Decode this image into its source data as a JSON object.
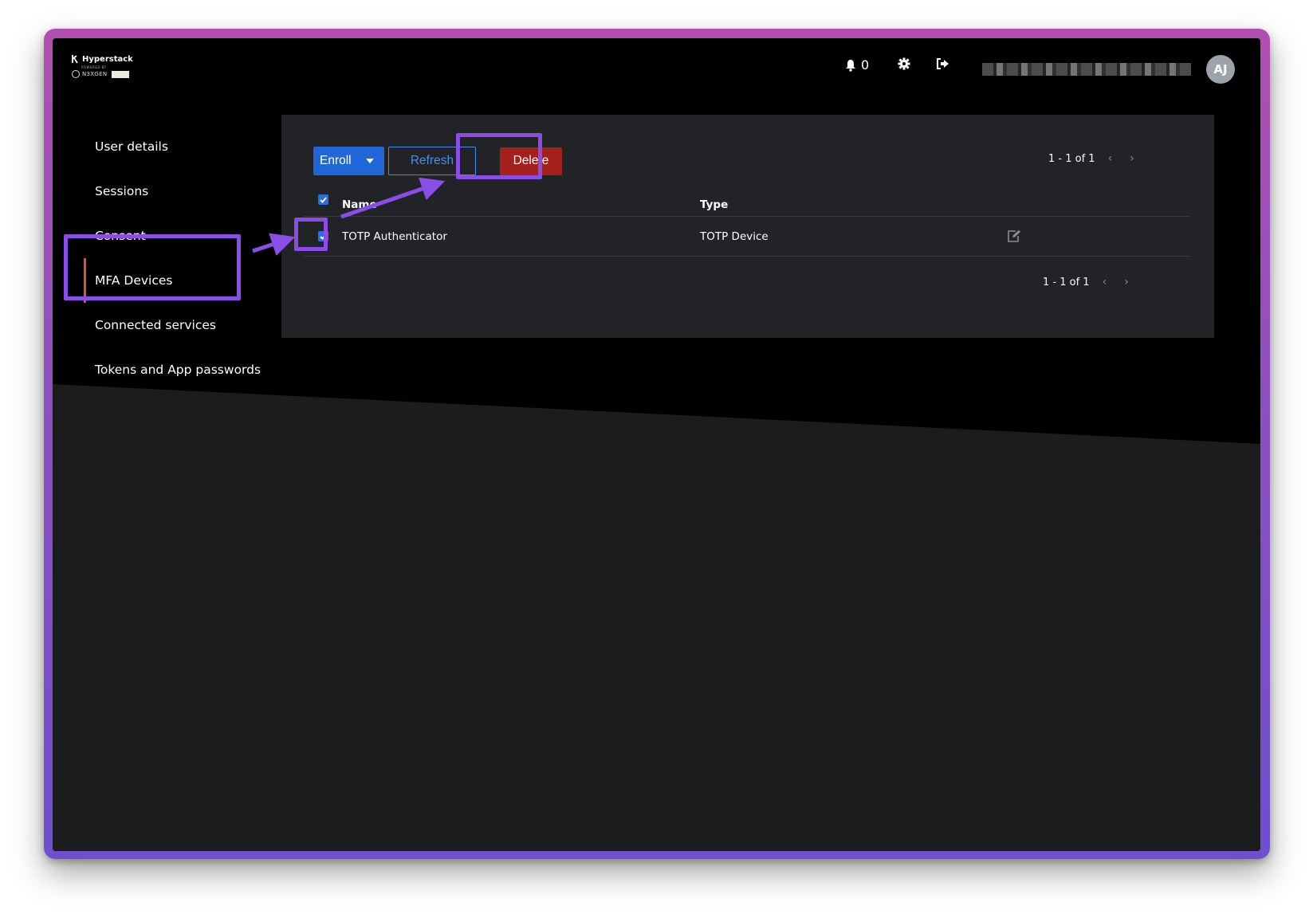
{
  "header": {
    "logo_brand": "Hyperstack",
    "logo_powered": "POWERED BY",
    "logo_sub": "N3XGEN",
    "notification_count": "0",
    "avatar_initials": "AJ"
  },
  "sidebar": {
    "items": [
      {
        "label": "User details"
      },
      {
        "label": "Sessions"
      },
      {
        "label": "Consent"
      },
      {
        "label": "MFA Devices"
      },
      {
        "label": "Connected services"
      },
      {
        "label": "Tokens and App passwords"
      }
    ],
    "active_index": 3
  },
  "toolbar": {
    "enroll_label": "Enroll",
    "refresh_label": "Refresh",
    "delete_label": "Delete"
  },
  "pagination": {
    "top_label": "1 - 1 of 1",
    "bottom_label": "1 - 1 of 1"
  },
  "table": {
    "columns": [
      "Name",
      "Type"
    ],
    "rows": [
      {
        "name": "TOTP Authenticator",
        "type": "TOTP Device",
        "checked": true
      }
    ],
    "select_all_checked": true
  },
  "colors": {
    "accent_blue": "#2166d6",
    "delete_red": "#a3201d",
    "active_bar": "#e0503d",
    "annotation_purple": "#8a4de8",
    "frame_gradient_top": "#b04fb0",
    "frame_gradient_bottom": "#6f4ed0"
  },
  "icons": {
    "bell": "bell-icon",
    "gear": "gear-icon",
    "logout": "logout-icon",
    "caret": "caret-down-icon",
    "prev": "chevron-left-icon",
    "next": "chevron-right-icon",
    "edit": "edit-icon"
  }
}
